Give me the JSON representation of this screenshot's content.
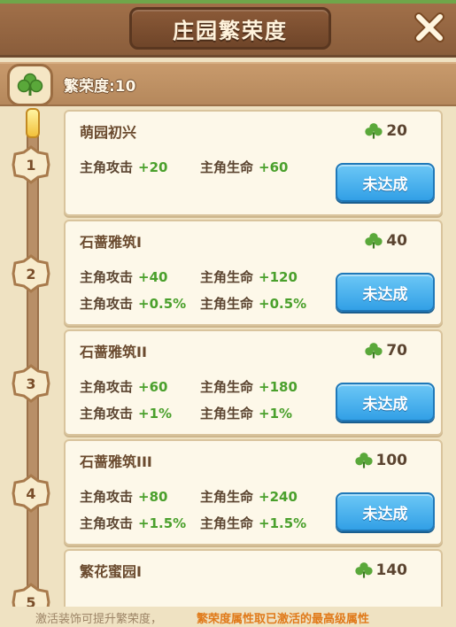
{
  "header": {
    "title": "庄园繁荣度"
  },
  "prosperity": {
    "label": "繁荣度:10"
  },
  "colors": {
    "accent_green": "#4aa02c",
    "button_blue": "#32a0e6",
    "panel_bg": "#efe2c2"
  },
  "levels": [
    {
      "num": "1",
      "title": "萌园初兴",
      "req": "20",
      "row1": {
        "atk_label": "主角攻击",
        "atk": "+20",
        "hp_label": "主角生命",
        "hp": "+60"
      },
      "row2": null,
      "button": "未达成"
    },
    {
      "num": "2",
      "title": "石蔷雅筑I",
      "req": "40",
      "row1": {
        "atk_label": "主角攻击",
        "atk": "+40",
        "hp_label": "主角生命",
        "hp": "+120"
      },
      "row2": {
        "atk_label": "主角攻击",
        "atk": "+0.5%",
        "hp_label": "主角生命",
        "hp": "+0.5%"
      },
      "button": "未达成"
    },
    {
      "num": "3",
      "title": "石蔷雅筑II",
      "req": "70",
      "row1": {
        "atk_label": "主角攻击",
        "atk": "+60",
        "hp_label": "主角生命",
        "hp": "+180"
      },
      "row2": {
        "atk_label": "主角攻击",
        "atk": "+1%",
        "hp_label": "主角生命",
        "hp": "+1%"
      },
      "button": "未达成"
    },
    {
      "num": "4",
      "title": "石蔷雅筑III",
      "req": "100",
      "row1": {
        "atk_label": "主角攻击",
        "atk": "+80",
        "hp_label": "主角生命",
        "hp": "+240"
      },
      "row2": {
        "atk_label": "主角攻击",
        "atk": "+1.5%",
        "hp_label": "主角生命",
        "hp": "+1.5%"
      },
      "button": "未达成"
    },
    {
      "num": "5",
      "title": "繁花蜜园I",
      "req": "140"
    }
  ],
  "footer": {
    "note": "激活装饰可提升繁荣度，",
    "highlight": "繁荣度属性取已激活的最高级属性"
  }
}
